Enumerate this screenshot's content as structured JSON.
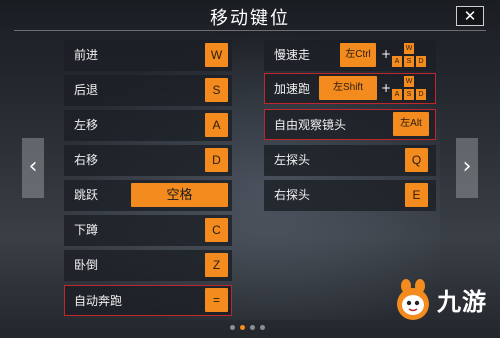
{
  "title": "移动键位",
  "close_label": "✕",
  "nav": {
    "prev": "‹",
    "next": "›"
  },
  "left_column": [
    {
      "label": "前进",
      "key": "W"
    },
    {
      "label": "后退",
      "key": "S"
    },
    {
      "label": "左移",
      "key": "A"
    },
    {
      "label": "右移",
      "key": "D"
    },
    {
      "label": "跳跃",
      "key": "空格"
    },
    {
      "label": "下蹲",
      "key": "C"
    },
    {
      "label": "卧倒",
      "key": "Z"
    },
    {
      "label": "自动奔跑",
      "key": "="
    }
  ],
  "right_column": [
    {
      "label": "慢速走",
      "key": "左Ctrl",
      "plus": "+",
      "combo": [
        "W",
        "A",
        "S",
        "D"
      ]
    },
    {
      "label": "加速跑",
      "key": "左Shift",
      "plus": "+",
      "combo": [
        "W",
        "A",
        "S",
        "D"
      ]
    },
    {
      "label": "自由观察镜头",
      "key": "左Alt"
    },
    {
      "label": "左探头",
      "key": "Q"
    },
    {
      "label": "右探头",
      "key": "E"
    }
  ],
  "highlighted_rows": [
    "自动奔跑",
    "加速跑",
    "自由观察镜头"
  ],
  "pagination": {
    "total": 4,
    "active": 1
  },
  "watermark": {
    "text": "九游",
    "icon": "mascot-logo-icon"
  },
  "colors": {
    "accent": "#f48b1e",
    "highlight_border": "#c0272d",
    "row_bg": "#1c2026"
  }
}
